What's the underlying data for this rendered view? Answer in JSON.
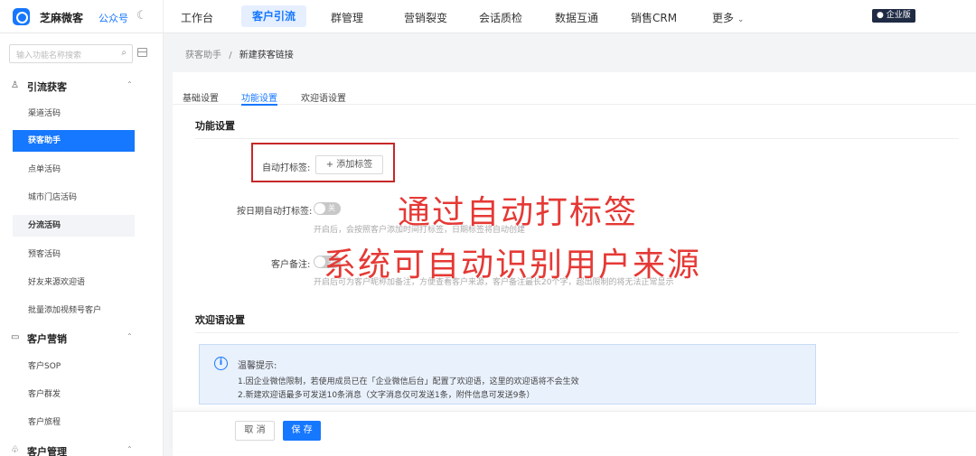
{
  "brand": {
    "name": "芝麻微客",
    "gzh": "公众号"
  },
  "nav": {
    "items": [
      "工作台",
      "客户引流",
      "群管理",
      "营销裂变",
      "会话质检",
      "数据互通",
      "销售CRM",
      "更多"
    ],
    "edition": "企业版"
  },
  "sidebar": {
    "search_placeholder": "输入功能名称搜索",
    "groups": [
      "引流获客",
      "客户营销",
      "客户管理"
    ],
    "items": [
      "渠道活码",
      "获客助手",
      "点单活码",
      "城市门店活码",
      "分流活码",
      "预客活码",
      "好友来源欢迎语",
      "批量添加视频号客户",
      "客户SOP",
      "客户群发",
      "客户旅程"
    ]
  },
  "breadcrumb": {
    "parent": "获客助手",
    "sep": "/",
    "current": "新建获客链接"
  },
  "tabs": [
    "基础设置",
    "功能设置",
    "欢迎语设置"
  ],
  "form": {
    "section_title": "功能设置",
    "auto_tag_label": "自动打标签:",
    "add_tag_button": "+ 添加标签",
    "date_tag_label": "按日期自动打标签:",
    "toggle_off_text": "关",
    "date_tag_hint": "开启后，会按照客户添加时间打标签，日期标签将自动创建",
    "remark_label": "客户备注:",
    "remark_hint": "开启后可为客户昵称加备注，方便查看客户来源，客户备注最长20个字，超出限制的将无法正常显示"
  },
  "overlay": {
    "line1": "通过自动打标签",
    "line2": "系统可自动识别用户来源",
    "color": "#e53935"
  },
  "welcome": {
    "section_title": "欢迎语设置",
    "tip_title": "温馨提示:",
    "tip_lines": [
      "1.因企业微信限制，若使用成员已在「企业微信后台」配置了欢迎语，这里的欢迎语将不会生效",
      "2.新建欢迎语最多可发送10条消息（文字消息仅可发送1条，附件信息可发送9条）"
    ]
  },
  "footer": {
    "cancel": "取 消",
    "save": "保 存"
  },
  "colors": {
    "accent": "#1677ff",
    "annotation": "#c62828"
  }
}
